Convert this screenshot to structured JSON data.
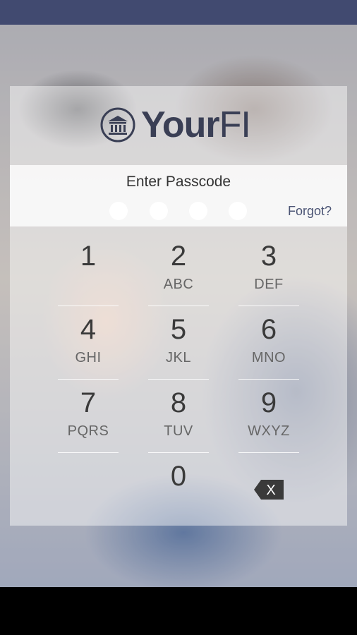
{
  "brand": {
    "name_bold": "Your",
    "name_light": "FI"
  },
  "passcode": {
    "title": "Enter Passcode",
    "forgot_label": "Forgot?",
    "dots_count": 4
  },
  "keypad": [
    {
      "digit": "1",
      "letters": ""
    },
    {
      "digit": "2",
      "letters": "ABC"
    },
    {
      "digit": "3",
      "letters": "DEF"
    },
    {
      "digit": "4",
      "letters": "GHI"
    },
    {
      "digit": "5",
      "letters": "JKL"
    },
    {
      "digit": "6",
      "letters": "MNO"
    },
    {
      "digit": "7",
      "letters": "PQRS"
    },
    {
      "digit": "8",
      "letters": "TUV"
    },
    {
      "digit": "9",
      "letters": "WXYZ"
    },
    {
      "digit": "0",
      "letters": ""
    }
  ],
  "backspace": {
    "label": "X",
    "icon": "backspace-icon"
  },
  "colors": {
    "status_bar": "#414a70",
    "brand": "#3a3f55",
    "link": "#4b5474"
  }
}
